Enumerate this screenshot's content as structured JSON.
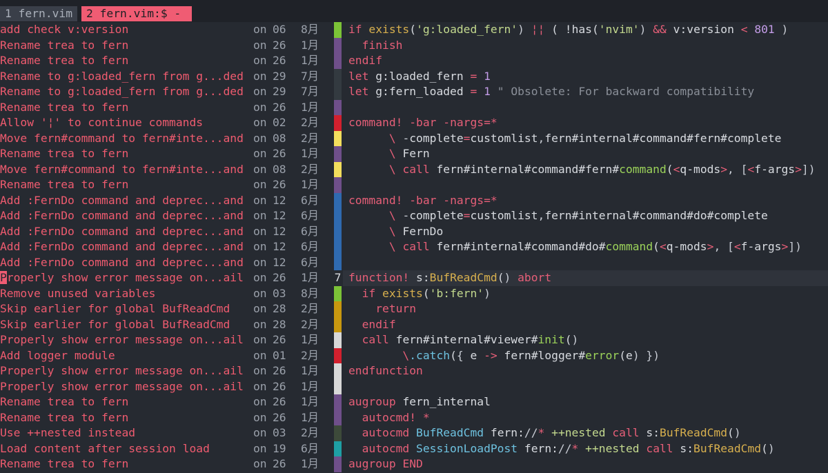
{
  "tabs": [
    {
      "label": "1 fern.vim"
    },
    {
      "label": "2 fern.vim:$ -"
    }
  ],
  "colors": {
    "accent": "#f05c73",
    "commit_message": "#ef5b6f",
    "stripe_green": "#7cc337",
    "stripe_purple": "#6f4f8a",
    "stripe_dark": "#333a40",
    "stripe_red": "#d2202e",
    "stripe_yellow": "#f3de5d",
    "stripe_blue": "#2f6ab0",
    "stripe_gold": "#c8980f",
    "stripe_light": "#d8d8d8",
    "stripe_olive": "#3d4a3a",
    "stripe_teal": "#1e9fa4"
  },
  "blame": [
    {
      "msg": "add check v:version",
      "on": "on",
      "day": "06",
      "month": "8月",
      "stripe": "#7cc337"
    },
    {
      "msg": "Rename trea to fern",
      "on": "on",
      "day": "26",
      "month": "1月",
      "stripe": "#6f4f8a"
    },
    {
      "msg": "Rename trea to fern",
      "on": "on",
      "day": "26",
      "month": "1月",
      "stripe": "#6f4f8a"
    },
    {
      "msg": "Rename to g:loaded_fern from g...ded",
      "on": "on",
      "day": "29",
      "month": "7月",
      "stripe": "#333a40"
    },
    {
      "msg": "Rename to g:loaded_fern from g...ded",
      "on": "on",
      "day": "29",
      "month": "7月",
      "stripe": "#333a40"
    },
    {
      "msg": "Rename trea to fern",
      "on": "on",
      "day": "26",
      "month": "1月",
      "stripe": "#6f4f8a"
    },
    {
      "msg": "Allow '¦' to continue commands",
      "on": "on",
      "day": "02",
      "month": "2月",
      "stripe": "#d2202e"
    },
    {
      "msg": "Move fern#command to fern#inte...and",
      "on": "on",
      "day": "08",
      "month": "2月",
      "stripe": "#f3de5d"
    },
    {
      "msg": "Rename trea to fern",
      "on": "on",
      "day": "26",
      "month": "1月",
      "stripe": "#6f4f8a"
    },
    {
      "msg": "Move fern#command to fern#inte...and",
      "on": "on",
      "day": "08",
      "month": "2月",
      "stripe": "#f3de5d"
    },
    {
      "msg": "Rename trea to fern",
      "on": "on",
      "day": "26",
      "month": "1月",
      "stripe": "#6f4f8a"
    },
    {
      "msg": "Add :FernDo command and deprec...and",
      "on": "on",
      "day": "12",
      "month": "6月",
      "stripe": "#2f6ab0"
    },
    {
      "msg": "Add :FernDo command and deprec...and",
      "on": "on",
      "day": "12",
      "month": "6月",
      "stripe": "#2f6ab0"
    },
    {
      "msg": "Add :FernDo command and deprec...and",
      "on": "on",
      "day": "12",
      "month": "6月",
      "stripe": "#2f6ab0"
    },
    {
      "msg": "Add :FernDo command and deprec...and",
      "on": "on",
      "day": "12",
      "month": "6月",
      "stripe": "#2f6ab0"
    },
    {
      "msg": "Add :FernDo command and deprec...and",
      "on": "on",
      "day": "12",
      "month": "6月",
      "stripe": "#2f6ab0"
    },
    {
      "msg": "Properly show error message on...ail",
      "on": "on",
      "day": "26",
      "month": "1月",
      "stripe": "",
      "lnum": "7"
    },
    {
      "msg": "Remove unused variables",
      "on": "on",
      "day": "03",
      "month": "8月",
      "stripe": "#7cc337"
    },
    {
      "msg": "Skip earlier for global BufReadCmd",
      "on": "on",
      "day": "28",
      "month": "2月",
      "stripe": "#c8980f"
    },
    {
      "msg": "Skip earlier for global BufReadCmd",
      "on": "on",
      "day": "28",
      "month": "2月",
      "stripe": "#c8980f"
    },
    {
      "msg": "Properly show error message on...ail",
      "on": "on",
      "day": "26",
      "month": "1月",
      "stripe": "#d8d8d8"
    },
    {
      "msg": "Add logger module",
      "on": "on",
      "day": "01",
      "month": "2月",
      "stripe": "#d2202e"
    },
    {
      "msg": "Properly show error message on...ail",
      "on": "on",
      "day": "26",
      "month": "1月",
      "stripe": "#d8d8d8"
    },
    {
      "msg": "Properly show error message on...ail",
      "on": "on",
      "day": "26",
      "month": "1月",
      "stripe": "#d8d8d8"
    },
    {
      "msg": "Rename trea to fern",
      "on": "on",
      "day": "26",
      "month": "1月",
      "stripe": "#6f4f8a"
    },
    {
      "msg": "Rename trea to fern",
      "on": "on",
      "day": "26",
      "month": "1月",
      "stripe": "#6f4f8a"
    },
    {
      "msg": "Use ++nested instead",
      "on": "on",
      "day": "03",
      "month": "2月",
      "stripe": "#3d4a3a"
    },
    {
      "msg": "Load content after session load",
      "on": "on",
      "day": "19",
      "month": "6月",
      "stripe": "#1e9fa4"
    },
    {
      "msg": "Rename trea to fern",
      "on": "on",
      "day": "26",
      "month": "1月",
      "stripe": "#6f4f8a"
    }
  ],
  "code_lines": [
    "if exists('g:loaded_fern') ¦¦ ( !has('nvim') && v:version < 801 )",
    "  finish",
    "endif",
    "let g:loaded_fern = 1",
    "let g:fern_loaded = 1 \" Obsolete: For backward compatibility",
    "",
    "command! -bar -nargs=*",
    "      \\ -complete=customlist,fern#internal#command#fern#complete",
    "      \\ Fern",
    "      \\ call fern#internal#command#fern#command(<q-mods>, [<f-args>])",
    "",
    "command! -bar -nargs=*",
    "      \\ -complete=customlist,fern#internal#command#do#complete",
    "      \\ FernDo",
    "      \\ call fern#internal#command#do#command(<q-mods>, [<f-args>])",
    "",
    "function! s:BufReadCmd() abort",
    "  if exists('b:fern')",
    "    return",
    "  endif",
    "  call fern#internal#viewer#init()",
    "        \\.catch({ e -> fern#logger#error(e) })",
    "endfunction",
    "",
    "augroup fern_internal",
    "  autocmd! *",
    "  autocmd BufReadCmd fern://* ++nested call s:BufReadCmd()",
    "  autocmd SessionLoadPost fern://* ++nested call s:BufReadCmd()",
    "augroup END"
  ],
  "cursor_row": 16
}
